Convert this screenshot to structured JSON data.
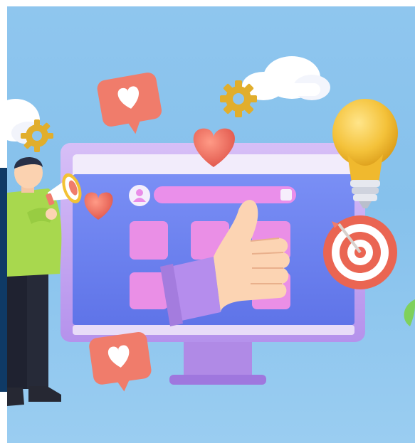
{
  "scene": {
    "description_elements": [
      "monitor",
      "thumbs-up-hand",
      "megaphone-person",
      "light-bulb",
      "target",
      "heart-speech-bubble",
      "cloud",
      "gear"
    ]
  },
  "colors": {
    "sky": "#8fc6ee",
    "monitor_frame": "#c9a8f2",
    "screen": "#6f86f2",
    "tile": "#e98de8",
    "heart_bubble": "#f07c6b",
    "bulb": "#f4c23a",
    "target_red": "#ea6552",
    "shirt": "#a8d84e"
  }
}
